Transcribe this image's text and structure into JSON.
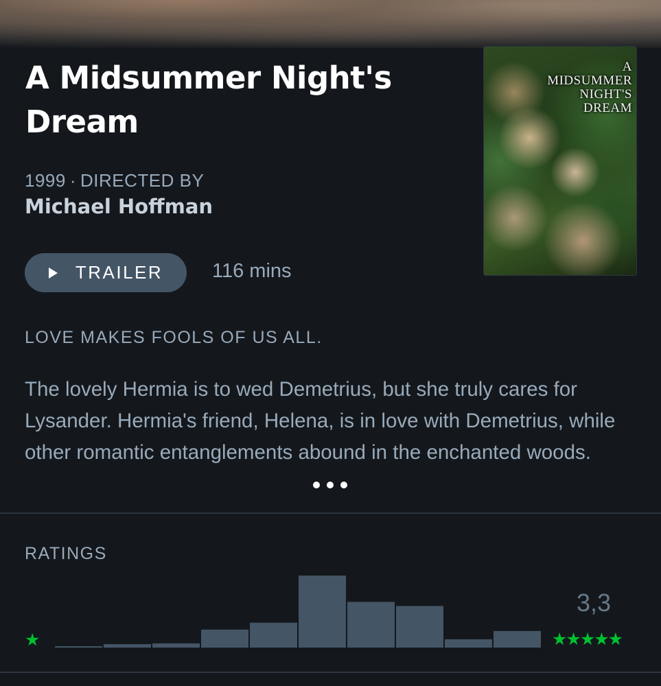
{
  "film": {
    "title": "A Midsummer Night's Dream",
    "year": "1999",
    "separator": "·",
    "directed_by_label": "DIRECTED BY",
    "director": "Michael Hoffman",
    "runtime": "116 mins",
    "tagline": "LOVE MAKES FOOLS OF US ALL.",
    "synopsis": "The lovely Hermia is to wed Demetrius, but she truly cares for Lysander. Hermia's friend, Helena, is in love with Demetrius, while other romantic entanglements abound in the enchanted woods.",
    "more_icon": "ellipsis-icon"
  },
  "poster": {
    "title_lines": [
      "A",
      "MIDSUMMER",
      "NIGHT'S",
      "DREAM"
    ]
  },
  "trailer": {
    "label": "TRAILER",
    "icon": "play-icon"
  },
  "ratings": {
    "label": "RATINGS",
    "average": "3,3",
    "low_star": "★",
    "high_stars": "★★★★★",
    "accent_color": "#00c030",
    "bar_color": "#445566"
  },
  "chart_data": {
    "type": "bar",
    "categories": [
      "0.5",
      "1",
      "1.5",
      "2",
      "2.5",
      "3",
      "3.5",
      "4",
      "4.5",
      "5"
    ],
    "values": [
      2,
      5,
      6,
      26,
      36,
      104,
      66,
      60,
      12,
      24
    ],
    "ylim": [
      0,
      104
    ]
  }
}
